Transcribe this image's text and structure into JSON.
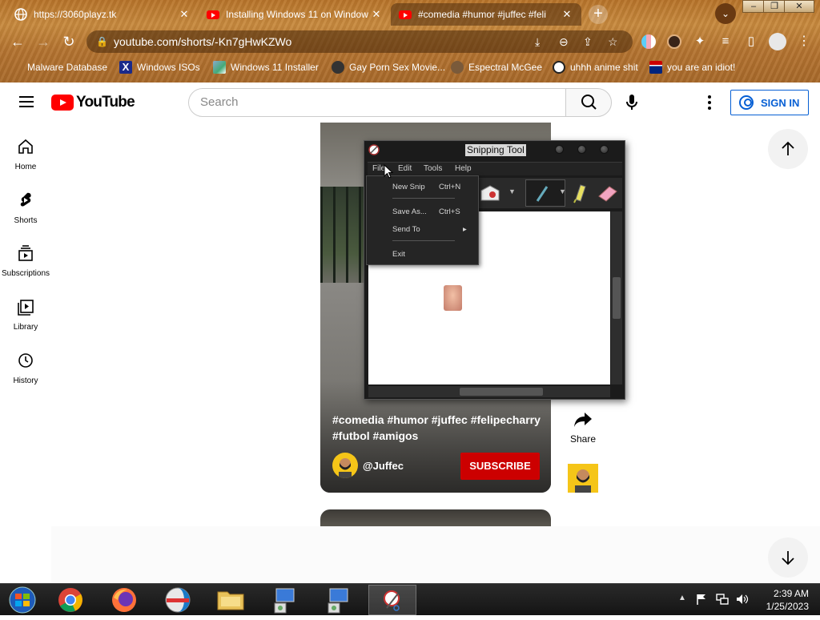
{
  "browser": {
    "tabs": [
      {
        "title": "https://3060playz.tk",
        "active": false
      },
      {
        "title": "Installing Windows 11 on Window",
        "active": false
      },
      {
        "title": "#comedia #humor #juffec #feli",
        "active": true
      }
    ],
    "url": "youtube.com/shorts/-Kn7gHwKZWo",
    "bookmarks": [
      {
        "label": "Malware Database",
        "icon": "skull-icon"
      },
      {
        "label": "Windows ISOs",
        "icon": "x-logo-icon"
      },
      {
        "label": "Windows 11 Installer",
        "icon": "image-icon"
      },
      {
        "label": "Gay Porn Sex Movie...",
        "icon": "site-icon"
      },
      {
        "label": "Espectral McGee",
        "icon": "cat-icon"
      },
      {
        "label": "uhhh anime shit",
        "icon": "anime-icon"
      },
      {
        "label": "you are an idiot!",
        "icon": "flag-icon"
      }
    ]
  },
  "youtube": {
    "logo_text": "YouTube",
    "search_placeholder": "Search",
    "sign_in": "SIGN IN",
    "sidebar": [
      {
        "label": "Home",
        "icon": "home-icon"
      },
      {
        "label": "Shorts",
        "icon": "shorts-icon"
      },
      {
        "label": "Subscriptions",
        "icon": "subscriptions-icon"
      },
      {
        "label": "Library",
        "icon": "library-icon"
      },
      {
        "label": "History",
        "icon": "history-icon"
      }
    ],
    "short": {
      "title": "#comedia #humor #juffec #felipecharry #futbol #amigos",
      "channel": "@Juffec",
      "subscribe": "SUBSCRIBE",
      "share": "Share"
    }
  },
  "snipping_tool": {
    "title": "Snipping Tool",
    "menus": [
      "File",
      "Edit",
      "Tools",
      "Help"
    ],
    "file_menu": [
      {
        "label": "New Snip",
        "shortcut": "Ctrl+N"
      },
      {
        "label": "Save As...",
        "shortcut": "Ctrl+S"
      },
      {
        "label": "Send To",
        "shortcut": ""
      },
      {
        "label": "Exit",
        "shortcut": ""
      }
    ]
  },
  "taskbar": {
    "time": "2:39 AM",
    "date": "1/25/2023",
    "apps": [
      "start-orb",
      "chrome",
      "firefox",
      "other-browser",
      "file-explorer",
      "computer-1",
      "computer-2",
      "snipping-tool"
    ]
  },
  "colors": {
    "youtube_red": "#ff0000",
    "subscribe_red": "#cc0000",
    "signin_blue": "#065fd4",
    "chrome_brown": "#b8742a"
  }
}
